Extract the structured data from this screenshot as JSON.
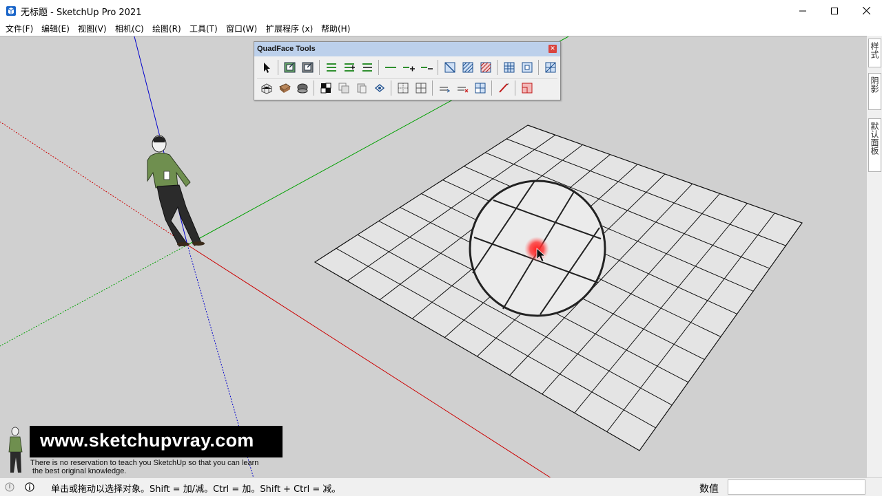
{
  "window": {
    "title": "无标题 - SketchUp Pro 2021",
    "icon": "sketchup-logo-icon"
  },
  "menu": [
    {
      "label": "文件(F)"
    },
    {
      "label": "编辑(E)"
    },
    {
      "label": "视图(V)"
    },
    {
      "label": "相机(C)"
    },
    {
      "label": "绘图(R)"
    },
    {
      "label": "工具(T)"
    },
    {
      "label": "窗口(W)"
    },
    {
      "label": "扩展程序 (x)"
    },
    {
      "label": "帮助(H)"
    }
  ],
  "right_panel": {
    "tabs": [
      {
        "label": "样式"
      },
      {
        "label": "阴影"
      },
      {
        "label": "默认面板"
      }
    ]
  },
  "toolbar": {
    "title": "QuadFace Tools",
    "close_icon": "close-icon",
    "row1_icons": [
      "select-icon",
      "smart-select-ring-icon",
      "smart-select-loop-icon",
      "select-ring-icon",
      "grow-ring-icon",
      "shrink-ring-icon",
      "select-loop-icon",
      "grow-loop-icon",
      "shrink-loop-icon",
      "region-to-loop-icon",
      "loop-to-region-icon",
      "selection-to-quads-icon",
      "build-ends-icon",
      "build-columns-icon",
      "flip-edge-icon"
    ],
    "row2_icons": [
      "uv-mapping-icon",
      "texture-map-icon",
      "texture-unwrap-icon",
      "triangulate-icon",
      "remove-triangulation-icon",
      "make-planar-icon",
      "wireframe-to-quads-icon",
      "offset-loop-icon",
      "connect-edges-icon",
      "insert-loops-icon",
      "remove-loops-icon",
      "build-corners-icon",
      "line-tool-icon",
      "convert-legacy-icon"
    ]
  },
  "viewport": {
    "watermark": {
      "url": "www.sketchupvray.com",
      "line1": "There is no reservation to teach you SketchUp so that you can learn",
      "line2": "the best original knowledge."
    }
  },
  "statusbar": {
    "text": "单击或拖动以选择对象。Shift = 加/减。Ctrl = 加。Shift + Ctrl = 减。",
    "measure_label": "数值",
    "measure_value": ""
  },
  "colors": {
    "viewport_bg": "#d0d0d0",
    "axis_red": "#cc0000",
    "axis_green": "#00a000",
    "axis_blue": "#0000cc",
    "toolbar_title_bg": "#bcd0eb"
  }
}
